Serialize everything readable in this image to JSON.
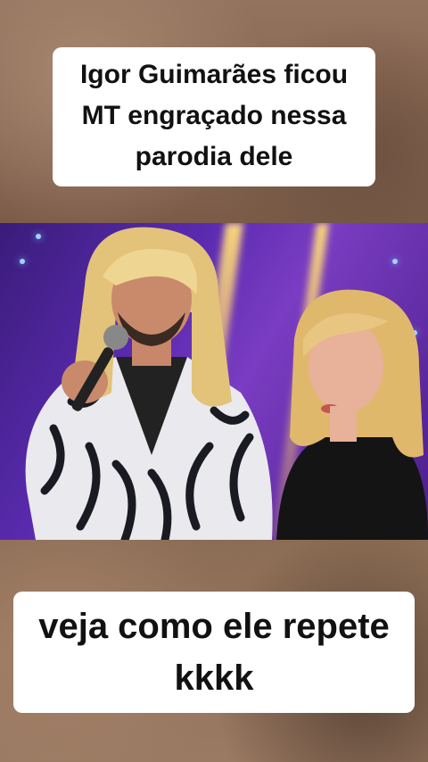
{
  "captions": {
    "top": "Igor Guimarães ficou MT engraçado nessa parodia dele",
    "bottom": "veja como ele repete kkkk"
  },
  "colors": {
    "caption_bg": "#ffffff",
    "caption_text": "#111111",
    "stage_purple": "#5b2bb0"
  }
}
